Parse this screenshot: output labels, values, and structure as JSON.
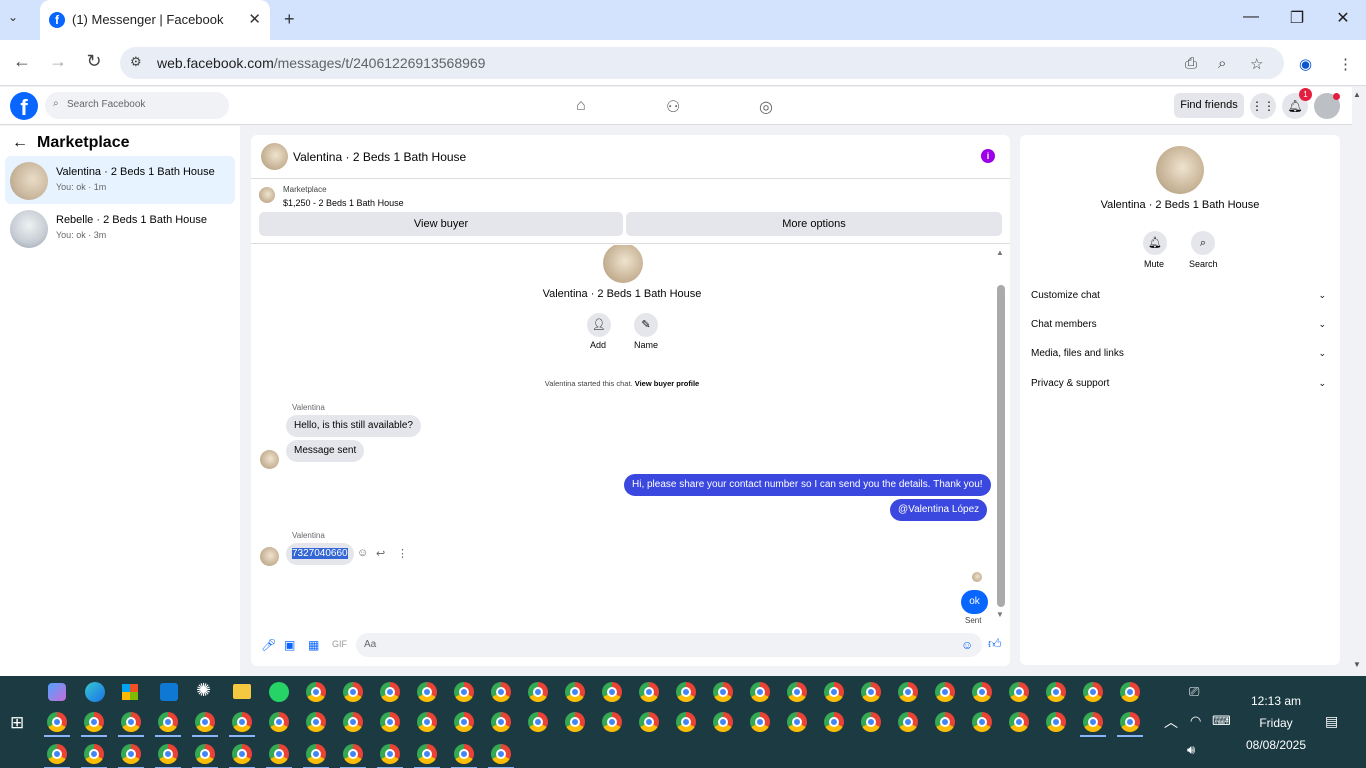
{
  "browser": {
    "tab_title": "(1) Messenger | Facebook",
    "url_host": "web.facebook.com",
    "url_path": "/messages/t/24061226913568969"
  },
  "fb_header": {
    "search_placeholder": "Search Facebook",
    "find_friends": "Find friends",
    "notification_count": "1"
  },
  "sidebar": {
    "title": "Marketplace",
    "conversations": [
      {
        "name": "Valentina · 2 Beds 1 Bath House",
        "sub": "You: ok · 1m"
      },
      {
        "name": "Rebelle · 2 Beds 1 Bath House",
        "sub": "You: ok · 3m"
      }
    ]
  },
  "chat": {
    "title": "Valentina · 2 Beds 1 Bath House",
    "listing_label": "Marketplace",
    "listing_price": "$1,250 - 2 Beds 1 Bath House",
    "view_buyer": "View buyer",
    "more_options": "More options",
    "profile_name": "Valentina · 2 Beds 1 Bath House",
    "add_label": "Add",
    "name_label": "Name",
    "started_text": "Valentina started this chat.",
    "view_buyer_profile": "View buyer profile",
    "sender1": "Valentina",
    "msg1": "Hello, is this still available?",
    "msg2": "Message sent",
    "msg3": "Hi, please share your contact number so I can send you the details. Thank you!",
    "msg4": "@Valentina López",
    "sender2": "Valentina",
    "msg5": "7327040660",
    "msg6": "ok",
    "sent_status": "Sent",
    "composer_placeholder": "Aa"
  },
  "right_panel": {
    "name": "Valentina · 2 Beds 1 Bath House",
    "mute": "Mute",
    "search": "Search",
    "sections": [
      "Customize chat",
      "Chat members",
      "Media, files and links",
      "Privacy & support"
    ]
  },
  "taskbar": {
    "time": "12:13 am",
    "day": "Friday",
    "date": "08/08/2025"
  }
}
